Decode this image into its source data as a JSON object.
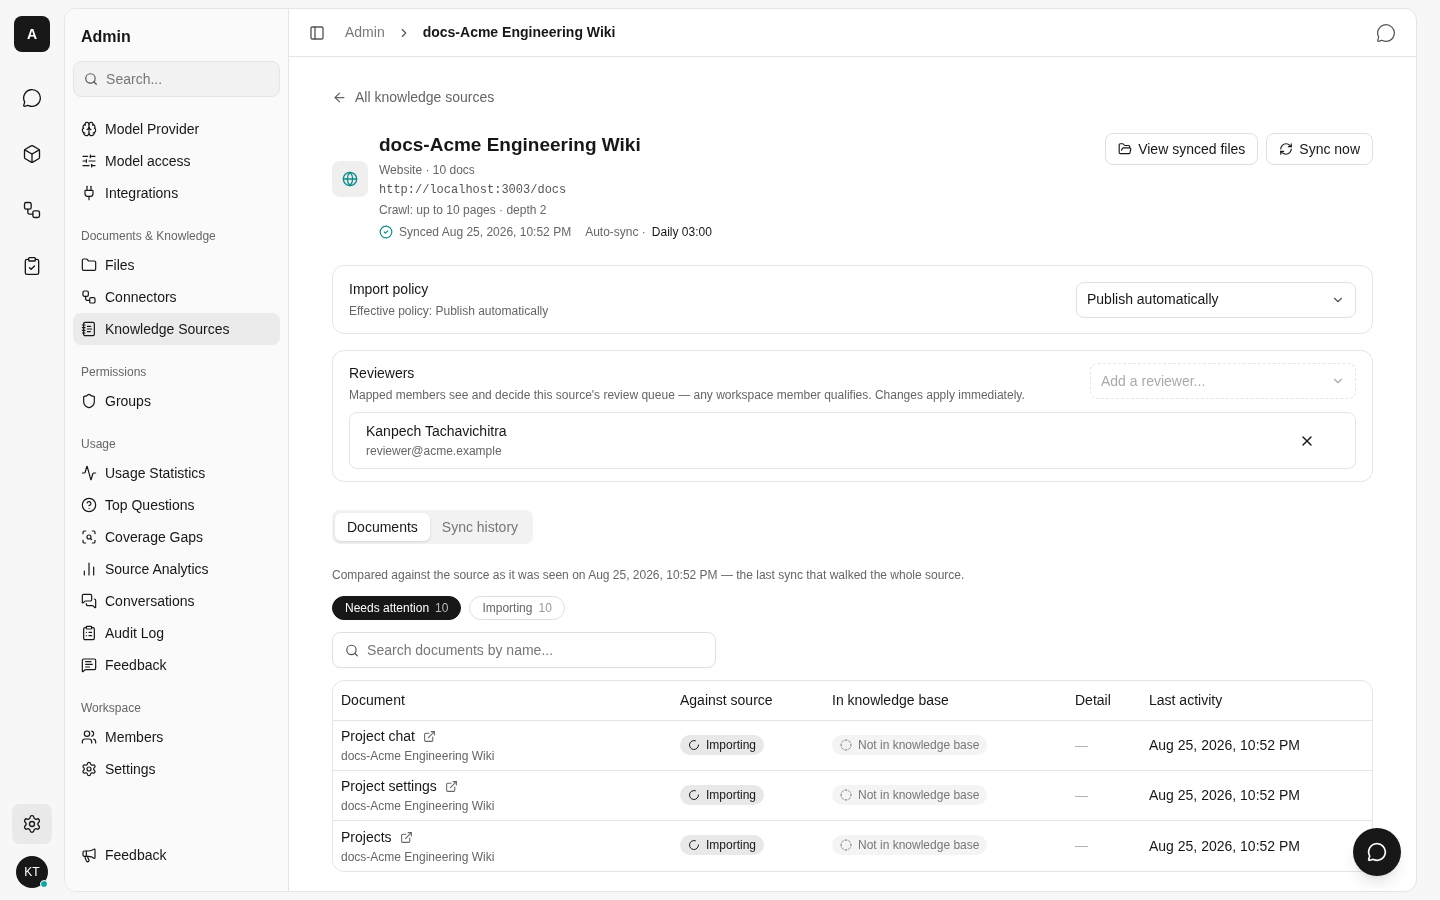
{
  "rail": {
    "logo": "A",
    "settings": {
      "selected": true
    },
    "avatar": {
      "initials": "KT",
      "online": true
    }
  },
  "sidebar": {
    "title": "Admin",
    "search": {
      "placeholder": "Search..."
    },
    "groups": [
      {
        "items": [
          {
            "label": "Model Provider",
            "selected": false
          },
          {
            "label": "Model access",
            "selected": false
          },
          {
            "label": "Integrations",
            "selected": false
          }
        ]
      },
      {
        "heading": "Documents & Knowledge",
        "items": [
          {
            "label": "Files",
            "selected": false
          },
          {
            "label": "Connectors",
            "selected": false
          },
          {
            "label": "Knowledge Sources",
            "selected": true
          }
        ]
      },
      {
        "heading": "Permissions",
        "items": [
          {
            "label": "Groups",
            "selected": false
          }
        ]
      },
      {
        "heading": "Usage",
        "items": [
          {
            "label": "Usage Statistics",
            "selected": false
          },
          {
            "label": "Top Questions",
            "selected": false
          },
          {
            "label": "Coverage Gaps",
            "selected": false
          },
          {
            "label": "Source Analytics",
            "selected": false
          },
          {
            "label": "Conversations",
            "selected": false
          },
          {
            "label": "Audit Log",
            "selected": false
          },
          {
            "label": "Feedback",
            "selected": false
          }
        ]
      },
      {
        "heading": "Workspace",
        "items": [
          {
            "label": "Members",
            "selected": false
          },
          {
            "label": "Settings",
            "selected": false
          }
        ]
      }
    ],
    "footer": "Feedback"
  },
  "breadcrumb": [
    "Admin",
    "docs-Acme Engineering Wiki"
  ],
  "back_link": "All knowledge sources",
  "source": {
    "title": "docs-Acme Engineering Wiki",
    "meta": "Website · 10 docs",
    "url": "http://localhost:3003/docs",
    "crawl": "Crawl: up to 10 pages · depth 2",
    "synced": "Synced Aug 25, 2026, 10:52 PM",
    "auto_sync_label": "Auto-sync ·",
    "auto_sync_value": "Daily 03:00"
  },
  "actions": [
    "View synced files",
    "Sync now"
  ],
  "import_policy": {
    "title": "Import policy",
    "subtitle": "Effective policy: Publish automatically",
    "value": "Publish automatically"
  },
  "reviewers": {
    "title": "Reviewers",
    "subtitle": "Mapped members see and decide this source's review queue — any workspace member qualifies. Changes apply immediately.",
    "placeholder": "Add a reviewer...",
    "members": [
      {
        "name": "Kanpech Tachavichitra",
        "email": "reviewer@acme.example"
      }
    ]
  },
  "tabs": [
    {
      "label": "Documents",
      "selected": true
    },
    {
      "label": "Sync history",
      "selected": false
    }
  ],
  "note": "Compared against the source as it was seen on Aug 25, 2026, 10:52 PM — the last sync that walked the whole source.",
  "filters": [
    {
      "label": "Needs attention",
      "count": "10",
      "selected": true
    },
    {
      "label": "Importing",
      "count": "10",
      "selected": false
    }
  ],
  "doc_search": {
    "placeholder": "Search documents by name..."
  },
  "table": {
    "columns": [
      "Document",
      "Against source",
      "In knowledge base",
      "Detail",
      "Last activity"
    ],
    "rows": [
      {
        "name": "Project chat",
        "source": "docs-Acme Engineering Wiki",
        "against": "Importing",
        "kb": "Not in knowledge base",
        "detail": "—",
        "last": "Aug 25, 2026, 10:52 PM"
      },
      {
        "name": "Project settings",
        "source": "docs-Acme Engineering Wiki",
        "against": "Importing",
        "kb": "Not in knowledge base",
        "detail": "—",
        "last": "Aug 25, 2026, 10:52 PM"
      },
      {
        "name": "Projects",
        "source": "docs-Acme Engineering Wiki",
        "against": "Importing",
        "kb": "Not in knowledge base",
        "detail": "—",
        "last": "Aug 25, 2026, 10:52 PM"
      }
    ]
  }
}
